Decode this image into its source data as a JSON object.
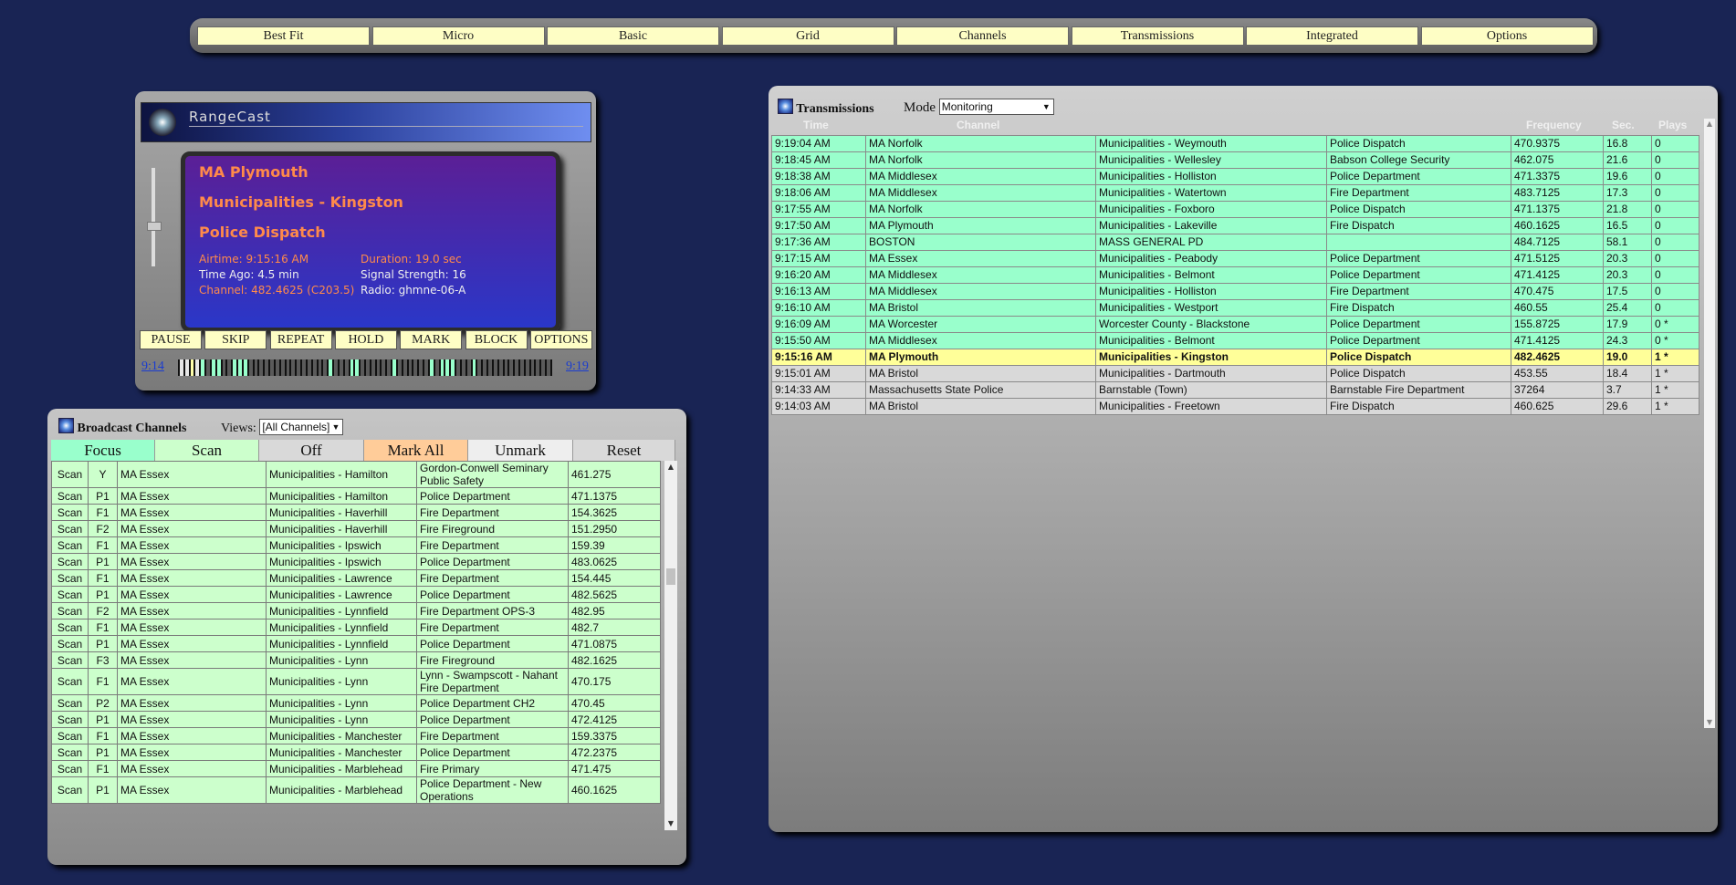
{
  "nav": {
    "items": [
      "Best Fit",
      "Micro",
      "Basic",
      "Grid",
      "Channels",
      "Transmissions",
      "Integrated",
      "Options"
    ]
  },
  "player": {
    "brand": "RangeCast",
    "line1": "MA Plymouth",
    "line2": "Municipalities - Kingston",
    "line3": "Police Dispatch",
    "airtime": "Airtime: 9:15:16 AM",
    "duration": "Duration: 19.0 sec",
    "time_ago": "Time Ago: 4.5 min",
    "signal": "Signal Strength: 16",
    "channel": "Channel: 482.4625 (C203.5)",
    "radio": "Radio: ghmne-06-A",
    "controls": [
      "PAUSE",
      "SKIP",
      "REPEAT",
      "HOLD",
      "MARK",
      "BLOCK",
      "OPTIONS"
    ],
    "timeline_start": "9:14",
    "timeline_end": "9:19",
    "colors": {
      "accent_orange": "#ff8a4a",
      "screen_top": "#5b1f96",
      "screen_bottom": "#2a37c8"
    }
  },
  "broadcast": {
    "title": "Broadcast Channels",
    "views_label": "Views:",
    "views_value": "[All Channels]",
    "tabs": [
      {
        "label": "Focus",
        "color": "#99ffcc"
      },
      {
        "label": "Scan",
        "color": "#ccffcc"
      },
      {
        "label": "Off",
        "color": "#d9d9d9"
      },
      {
        "label": "Mark All",
        "color": "#ffcc99"
      },
      {
        "label": "Unmark",
        "color": "#eeeeee"
      },
      {
        "label": "Reset",
        "color": "#d9d9d9"
      }
    ],
    "rows": [
      [
        "Scan",
        "Y",
        "MA Essex",
        "Municipalities - Hamilton",
        "Gordon-Conwell Seminary Public Safety",
        "461.275"
      ],
      [
        "Scan",
        "P1",
        "MA Essex",
        "Municipalities - Hamilton",
        "Police Department",
        "471.1375"
      ],
      [
        "Scan",
        "F1",
        "MA Essex",
        "Municipalities - Haverhill",
        "Fire Department",
        "154.3625"
      ],
      [
        "Scan",
        "F2",
        "MA Essex",
        "Municipalities - Haverhill",
        "Fire Fireground",
        "151.2950"
      ],
      [
        "Scan",
        "F1",
        "MA Essex",
        "Municipalities - Ipswich",
        "Fire Department",
        "159.39"
      ],
      [
        "Scan",
        "P1",
        "MA Essex",
        "Municipalities - Ipswich",
        "Police Department",
        "483.0625"
      ],
      [
        "Scan",
        "F1",
        "MA Essex",
        "Municipalities - Lawrence",
        "Fire Department",
        "154.445"
      ],
      [
        "Scan",
        "P1",
        "MA Essex",
        "Municipalities - Lawrence",
        "Police Department",
        "482.5625"
      ],
      [
        "Scan",
        "F2",
        "MA Essex",
        "Municipalities - Lynnfield",
        "Fire Department OPS-3",
        "482.95"
      ],
      [
        "Scan",
        "F1",
        "MA Essex",
        "Municipalities - Lynnfield",
        "Fire Department",
        "482.7"
      ],
      [
        "Scan",
        "P1",
        "MA Essex",
        "Municipalities - Lynnfield",
        "Police Department",
        "471.0875"
      ],
      [
        "Scan",
        "F3",
        "MA Essex",
        "Municipalities - Lynn",
        "Fire Fireground",
        "482.1625"
      ],
      [
        "Scan",
        "F1",
        "MA Essex",
        "Municipalities - Lynn",
        "Lynn - Swampscott - Nahant Fire Department",
        "470.175"
      ],
      [
        "Scan",
        "P2",
        "MA Essex",
        "Municipalities - Lynn",
        "Police Department CH2",
        "470.45"
      ],
      [
        "Scan",
        "P1",
        "MA Essex",
        "Municipalities - Lynn",
        "Police Department",
        "472.4125"
      ],
      [
        "Scan",
        "F1",
        "MA Essex",
        "Municipalities - Manchester",
        "Fire Department",
        "159.3375"
      ],
      [
        "Scan",
        "P1",
        "MA Essex",
        "Municipalities - Manchester",
        "Police Department",
        "472.2375"
      ],
      [
        "Scan",
        "F1",
        "MA Essex",
        "Municipalities - Marblehead",
        "Fire Primary",
        "471.475"
      ],
      [
        "Scan",
        "P1",
        "MA Essex",
        "Municipalities - Marblehead",
        "Police Department - New Operations",
        "460.1625"
      ]
    ]
  },
  "transmissions": {
    "title": "Transmissions",
    "mode_label": "Mode",
    "mode_value": "Monitoring",
    "columns": {
      "time": "Time",
      "channel": "Channel",
      "frequency": "Frequency",
      "sec": "Sec.",
      "plays": "Plays"
    },
    "rows": [
      {
        "status": "past",
        "cells": [
          "9:19:04 AM",
          "MA Norfolk",
          "Municipalities - Weymouth",
          "Police Dispatch",
          "470.9375",
          "16.8",
          "0"
        ]
      },
      {
        "status": "past",
        "cells": [
          "9:18:45 AM",
          "MA Norfolk",
          "Municipalities - Wellesley",
          "Babson College Security",
          "462.075",
          "21.6",
          "0"
        ]
      },
      {
        "status": "past",
        "cells": [
          "9:18:38 AM",
          "MA Middlesex",
          "Municipalities - Holliston",
          "Police Department",
          "471.3375",
          "19.6",
          "0"
        ]
      },
      {
        "status": "past",
        "cells": [
          "9:18:06 AM",
          "MA Middlesex",
          "Municipalities - Watertown",
          "Fire Department",
          "483.7125",
          "17.3",
          "0"
        ]
      },
      {
        "status": "past",
        "cells": [
          "9:17:55 AM",
          "MA Norfolk",
          "Municipalities - Foxboro",
          "Police Dispatch",
          "471.1375",
          "21.8",
          "0"
        ]
      },
      {
        "status": "past",
        "cells": [
          "9:17:50 AM",
          "MA Plymouth",
          "Municipalities - Lakeville",
          "Fire Dispatch",
          "460.1625",
          "16.5",
          "0"
        ]
      },
      {
        "status": "past",
        "cells": [
          "9:17:36 AM",
          "BOSTON",
          "MASS GENERAL PD",
          "",
          "484.7125",
          "58.1",
          "0"
        ]
      },
      {
        "status": "past",
        "cells": [
          "9:17:15 AM",
          "MA Essex",
          "Municipalities - Peabody",
          "Police Department",
          "471.5125",
          "20.3",
          "0"
        ]
      },
      {
        "status": "past",
        "cells": [
          "9:16:20 AM",
          "MA Middlesex",
          "Municipalities - Belmont",
          "Police Department",
          "471.4125",
          "20.3",
          "0"
        ]
      },
      {
        "status": "past",
        "cells": [
          "9:16:13 AM",
          "MA Middlesex",
          "Municipalities - Holliston",
          "Fire Department",
          "470.475",
          "17.5",
          "0"
        ]
      },
      {
        "status": "past",
        "cells": [
          "9:16:10 AM",
          "MA Bristol",
          "Municipalities - Westport",
          "Fire Dispatch",
          "460.55",
          "25.4",
          "0"
        ]
      },
      {
        "status": "past",
        "cells": [
          "9:16:09 AM",
          "MA Worcester",
          "Worcester County - Blackstone",
          "Police Department",
          "155.8725",
          "17.9",
          "0 *"
        ]
      },
      {
        "status": "past",
        "cells": [
          "9:15:50 AM",
          "MA Middlesex",
          "Municipalities - Belmont",
          "Police Department",
          "471.4125",
          "24.3",
          "0 *"
        ]
      },
      {
        "status": "cur",
        "cells": [
          "9:15:16 AM",
          "MA Plymouth",
          "Municipalities - Kingston",
          "Police Dispatch",
          "482.4625",
          "19.0",
          "1 *"
        ]
      },
      {
        "status": "old",
        "cells": [
          "9:15:01 AM",
          "MA Bristol",
          "Municipalities - Dartmouth",
          "Police Dispatch",
          "453.55",
          "18.4",
          "1 *"
        ]
      },
      {
        "status": "old",
        "cells": [
          "9:14:33 AM",
          "Massachusetts State Police",
          "Barnstable (Town)",
          "Barnstable Fire Department",
          "37264",
          "3.7",
          "1 *"
        ]
      },
      {
        "status": "old",
        "cells": [
          "9:14:03 AM",
          "MA Bristol",
          "Municipalities - Freetown",
          "Fire Dispatch",
          "460.625",
          "29.6",
          "1 *"
        ]
      }
    ],
    "colors": {
      "past": "#99ffcc",
      "current": "#ffff99",
      "older": "#d9d9d9"
    }
  },
  "timeline_segments": [
    "white",
    "white",
    "yellow",
    "white",
    "teal",
    "dark",
    "teal",
    "teal",
    "dark",
    "dark",
    "teal",
    "teal",
    "teal",
    "dark",
    "dark",
    "dark",
    "dark",
    "dark",
    "dark",
    "dark",
    "dark",
    "dark",
    "dark",
    "dark",
    "dark",
    "dark",
    "dark",
    "dark",
    "teal",
    "dark",
    "dark",
    "dark",
    "teal",
    "teal",
    "dark",
    "dark",
    "dark",
    "dark",
    "dark",
    "dark",
    "teal",
    "dark",
    "dark",
    "dark",
    "dark",
    "dark",
    "dark",
    "teal",
    "dark",
    "teal",
    "teal",
    "teal",
    "dark",
    "dark",
    "dark",
    "teal",
    "dark",
    "dark",
    "dark",
    "dark",
    "dark",
    "dark",
    "dark",
    "dark",
    "dark",
    "dark",
    "dark",
    "dark",
    "dark",
    "dark"
  ]
}
